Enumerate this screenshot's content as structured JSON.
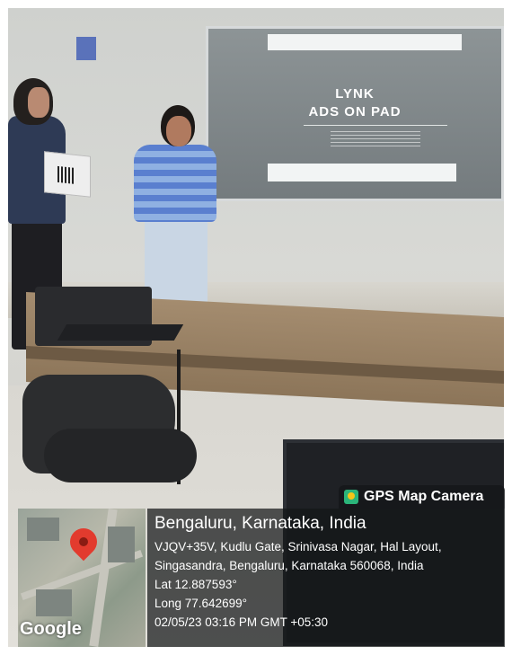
{
  "slide": {
    "line1": "LYNK",
    "line2": "ADS ON PAD"
  },
  "overlay": {
    "app_label": "GPS Map Camera",
    "city": "Bengaluru, Karnataka, India",
    "address_line1": "VJQV+35V, Kudlu Gate, Srinivasa Nagar, Hal Layout,",
    "address_line2": "Singasandra, Bengaluru, Karnataka 560068, India",
    "lat": "Lat 12.887593°",
    "long": "Long 77.642699°",
    "timestamp": "02/05/23 03:16 PM GMT +05:30",
    "map_brand": "Google"
  },
  "colors": {
    "pin": "#e23b2e",
    "overlay_bg": "#141618",
    "gps_icon": "#2bb57a"
  }
}
